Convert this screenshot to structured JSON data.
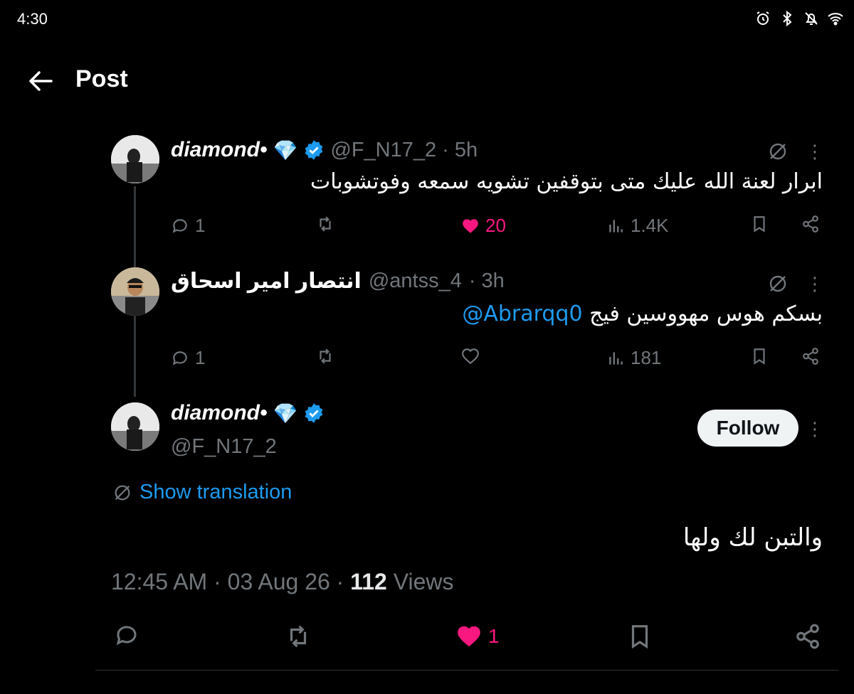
{
  "status_bar": {
    "time": "4:30"
  },
  "header": {
    "title": "Post"
  },
  "replies": [
    {
      "name": "diamond•",
      "emoji": "💎",
      "handle": "@F_N17_2",
      "time": "· 5h",
      "text": "ابرار لعنة الله عليك متى بتوقفين تشويه سمعه وفوتشوبات",
      "replies": "1",
      "likes": "20",
      "views": "1.4K"
    },
    {
      "name": "انتصار امير اسحاق",
      "handle": "@antss_4",
      "time": "· 3h",
      "text_before": "بسكم هوس مهووسين فيج ",
      "mention": "@Abrarqq0",
      "replies": "1",
      "views": "181"
    }
  ],
  "main_post": {
    "name": "diamond•",
    "emoji": "💎",
    "handle": "@F_N17_2",
    "follow_label": "Follow",
    "translate_label": "Show translation",
    "text": "والتبن لك ولها",
    "time": "12:45 AM",
    "date": "03 Aug 26",
    "views_count": "112",
    "views_label": "Views",
    "likes": "1"
  },
  "colors": {
    "accent": "#1d9bf0",
    "like": "#f91880",
    "muted": "#71767b"
  },
  "icons": [
    "back-arrow-icon",
    "verified-badge-icon",
    "translate-icon",
    "reply-icon",
    "retweet-icon",
    "like-icon",
    "views-icon",
    "bookmark-icon",
    "share-icon",
    "more-icon"
  ]
}
